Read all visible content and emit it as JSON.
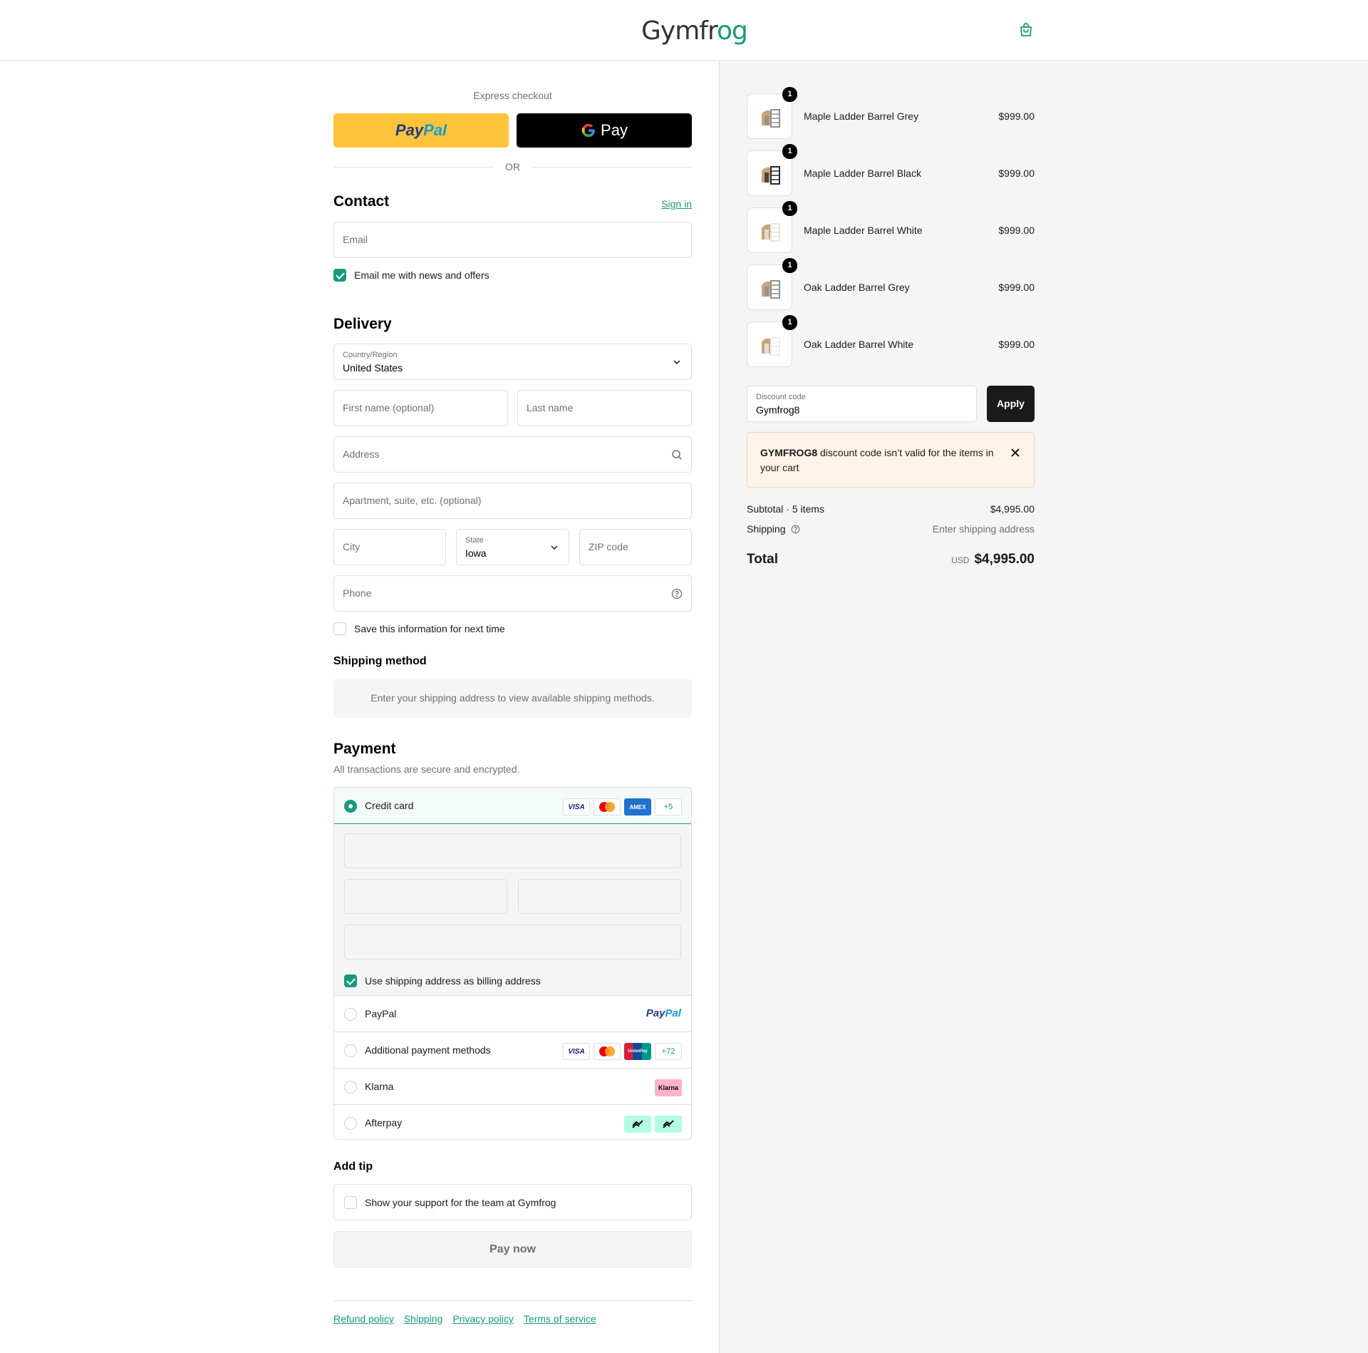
{
  "header": {
    "logo_main": "Gymfr",
    "logo_accent": "og"
  },
  "express": {
    "title": "Express checkout",
    "paypal_a": "Pay",
    "paypal_b": "Pal",
    "gpay_label": "Pay",
    "or": "OR"
  },
  "contact": {
    "title": "Contact",
    "sign_in": "Sign in",
    "email_placeholder": "Email",
    "news_label": "Email me with news and offers",
    "news_checked": true
  },
  "delivery": {
    "title": "Delivery",
    "country_label": "Country/Region",
    "country_value": "United States",
    "first_name_placeholder": "First name (optional)",
    "last_name_placeholder": "Last name",
    "address_placeholder": "Address",
    "apartment_placeholder": "Apartment, suite, etc. (optional)",
    "city_placeholder": "City",
    "state_label": "State",
    "state_value": "Iowa",
    "zip_placeholder": "ZIP code",
    "phone_placeholder": "Phone",
    "save_label": "Save this information for next time"
  },
  "shipping_method": {
    "title": "Shipping method",
    "notice": "Enter your shipping address to view available shipping methods."
  },
  "payment": {
    "title": "Payment",
    "subtitle": "All transactions are secure and encrypted.",
    "credit_card": "Credit card",
    "brands": {
      "visa": "VISA",
      "amex": "AMEX",
      "more_cards": "+5",
      "more_additional": "+72",
      "unionpay": "UnionPay",
      "klarna": "Klarna"
    },
    "billing_label": "Use shipping address as billing address",
    "paypal": "PayPal",
    "additional": "Additional payment methods",
    "klarna": "Klarna",
    "afterpay": "Afterpay"
  },
  "tip": {
    "title": "Add tip",
    "label": "Show your support for the team at Gymfrog"
  },
  "pay_now": "Pay now",
  "footer": {
    "links": [
      "Refund policy",
      "Shipping",
      "Privacy policy",
      "Terms of service"
    ]
  },
  "cart": {
    "items": [
      {
        "qty": "1",
        "name": "Maple Ladder Barrel Grey",
        "price": "$999.00",
        "color": "#8d8f91"
      },
      {
        "qty": "1",
        "name": "Maple Ladder Barrel Black",
        "price": "$999.00",
        "color": "#2a2a2a"
      },
      {
        "qty": "1",
        "name": "Maple Ladder Barrel White",
        "price": "$999.00",
        "color": "#e8e6e1"
      },
      {
        "qty": "1",
        "name": "Oak Ladder Barrel Grey",
        "price": "$999.00",
        "color": "#8d8f91"
      },
      {
        "qty": "1",
        "name": "Oak Ladder Barrel White",
        "price": "$999.00",
        "color": "#efede8"
      }
    ],
    "discount_label": "Discount code",
    "discount_value": "Gymfrog8",
    "apply": "Apply",
    "alert_code": "GYMFROG8",
    "alert_text": " discount code isn’t valid for the items in your cart",
    "subtotal_label": "Subtotal · 5 items",
    "subtotal_value": "$4,995.00",
    "shipping_label": "Shipping",
    "shipping_value": "Enter shipping address",
    "total_label": "Total",
    "currency": "USD",
    "total_value": "$4,995.00"
  },
  "colors": {
    "accent": "#169b7a",
    "paypal_yellow": "#ffc439"
  }
}
